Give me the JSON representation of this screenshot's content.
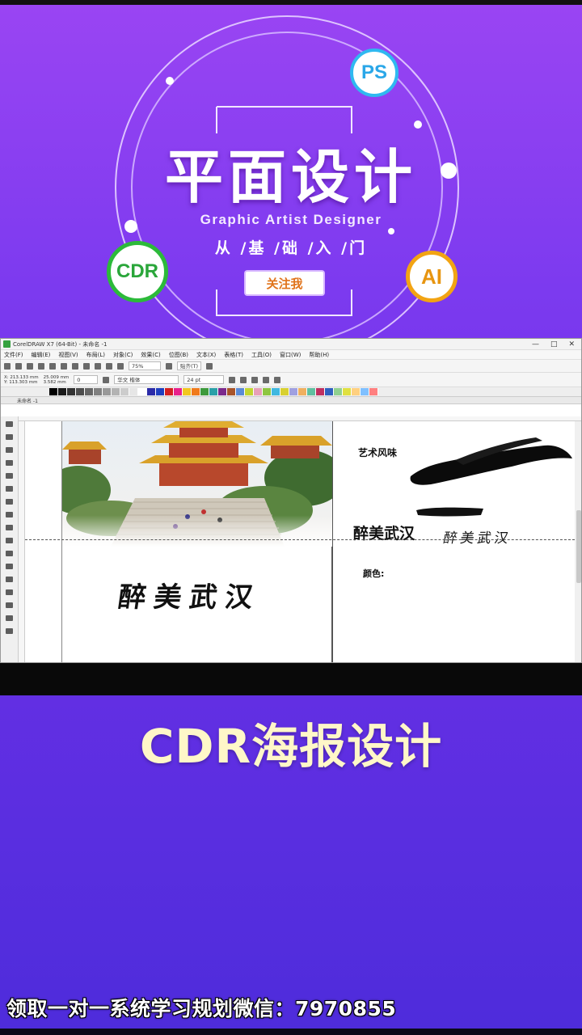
{
  "hero": {
    "title": "平面设计",
    "subtitle_en": "Graphic Artist Designer",
    "subtitle_cn": "从 /基 /础 /入 /门",
    "follow_label": "关注我",
    "badges": {
      "ps": "PS",
      "cdr": "CDR",
      "ai": "AI"
    },
    "colors": {
      "ps": "#2fb9f0",
      "cdr": "#2cba3a",
      "ai": "#f2a413"
    }
  },
  "app": {
    "window_title": "CorelDRAW X7 (64-Bit) - 未命名 -1",
    "window_controls": [
      "—",
      "□",
      "✕"
    ],
    "menu": [
      "文件(F)",
      "编辑(E)",
      "视图(V)",
      "布局(L)",
      "对象(C)",
      "效果(C)",
      "位图(B)",
      "文本(X)",
      "表格(T)",
      "工具(O)",
      "窗口(W)",
      "帮助(H)"
    ],
    "zoom": "75%",
    "snap_label": "贴齐(T)",
    "position": {
      "x": "X: 213.133 mm",
      "y": "Y: 113.303 mm"
    },
    "size": {
      "w": "25.009 mm",
      "h": "3.582 mm"
    },
    "rotation": "0",
    "font_name": "华文 楷体",
    "font_size": "24 pt",
    "document_tab": "未命名 -1"
  },
  "canvas": {
    "calligraphy_main": "醉美武汉",
    "label_art": "艺术风味",
    "heading_right": "醉美武汉",
    "calligraphy_small": "醉美武汉",
    "label_color": "颜色:"
  },
  "caption": "CDR海报设计",
  "footer": "领取一对一系统学习规划微信：7970855",
  "palette_colors": [
    "#000000",
    "#1a1a1a",
    "#333333",
    "#4d4d4d",
    "#666666",
    "#808080",
    "#999999",
    "#b3b3b3",
    "#cccccc",
    "#e6e6e6",
    "#ffffff",
    "#2b2ba8",
    "#1f3fbf",
    "#d42020",
    "#e8218c",
    "#f2c61f",
    "#f07a1b",
    "#3e9a3c",
    "#2aa0a8",
    "#7b2a8c",
    "#a8542a",
    "#5a8bd6",
    "#c2d630",
    "#e8a0b8",
    "#8ec640",
    "#40b8e0",
    "#d8d030",
    "#a0a0e0",
    "#f0b060",
    "#60c0a0",
    "#c03060",
    "#3060c0",
    "#90d090",
    "#e0e040",
    "#ffd080",
    "#80c0ff",
    "#ff8080"
  ]
}
